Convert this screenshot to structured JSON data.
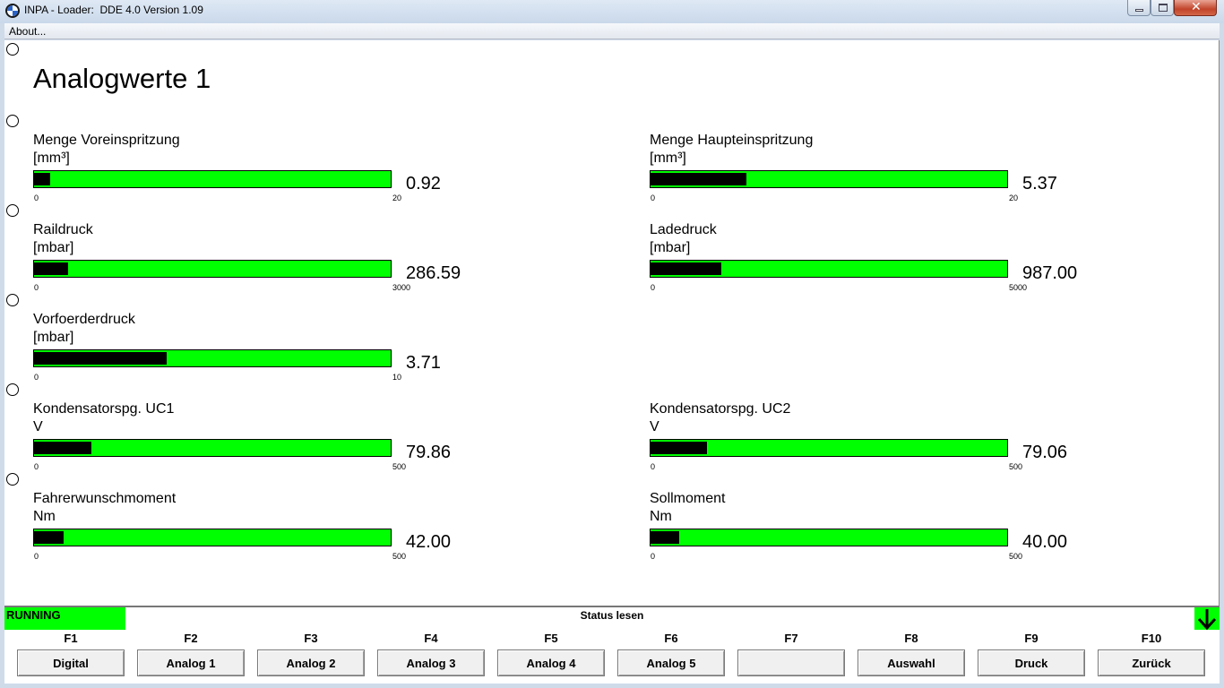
{
  "window": {
    "title": "INPA - Loader:  DDE 4.0 Version 1.09",
    "close_glyph": "✕"
  },
  "menu": {
    "about": "About..."
  },
  "page": {
    "title": "Analogwerte 1"
  },
  "gauges": [
    {
      "label": "Menge Voreinspritzung",
      "unit": "[mm³]",
      "value": "0.92",
      "min": "0",
      "max": "20",
      "fraction": 0.046
    },
    {
      "label": "Menge Haupteinspritzung",
      "unit": "[mm³]",
      "value": "5.37",
      "min": "0",
      "max": "20",
      "fraction": 0.2685
    },
    {
      "label": "Raildruck",
      "unit": "[mbar]",
      "value": "286.59",
      "min": "0",
      "max": "3000",
      "fraction": 0.0955
    },
    {
      "label": "Ladedruck",
      "unit": "[mbar]",
      "value": "987.00",
      "min": "0",
      "max": "5000",
      "fraction": 0.1974
    },
    {
      "label": "Vorfoerderdruck",
      "unit": "[mbar]",
      "value": "3.71",
      "min": "0",
      "max": "10",
      "fraction": 0.371
    },
    {
      "label": "Kondensatorspg. UC1",
      "unit": "V",
      "value": "79.86",
      "min": "0",
      "max": "500",
      "fraction": 0.1597
    },
    {
      "label": "Kondensatorspg. UC2",
      "unit": "V",
      "value": "79.06",
      "min": "0",
      "max": "500",
      "fraction": 0.1581
    },
    {
      "label": "Fahrerwunschmoment",
      "unit": "Nm",
      "value": "42.00",
      "min": "0",
      "max": "500",
      "fraction": 0.084
    },
    {
      "label": "Sollmoment",
      "unit": "Nm",
      "value": "40.00",
      "min": "0",
      "max": "500",
      "fraction": 0.08
    }
  ],
  "status": {
    "state": "RUNNING",
    "text": "Status lesen"
  },
  "fkeys": [
    {
      "key": "F1",
      "label": "Digital"
    },
    {
      "key": "F2",
      "label": "Analog 1"
    },
    {
      "key": "F3",
      "label": "Analog 2"
    },
    {
      "key": "F4",
      "label": "Analog 3"
    },
    {
      "key": "F5",
      "label": "Analog 4"
    },
    {
      "key": "F6",
      "label": "Analog 5"
    },
    {
      "key": "F7",
      "label": ""
    },
    {
      "key": "F8",
      "label": "Auswahl"
    },
    {
      "key": "F9",
      "label": "Druck"
    },
    {
      "key": "F10",
      "label": "Zurück"
    }
  ],
  "colors": {
    "bar": "#00ff00",
    "fill": "#000000",
    "running": "#00ff00"
  }
}
